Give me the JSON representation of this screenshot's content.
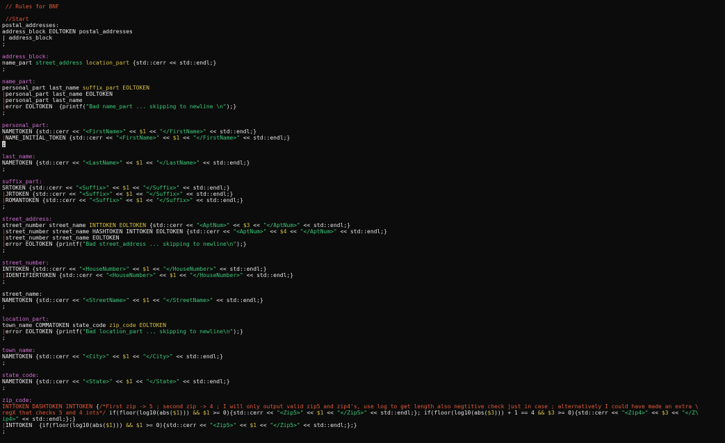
{
  "colors": {
    "background": "#0c0c0c",
    "plain": "#e6e6e6",
    "rule": "#d070d0",
    "comment": "#e05a3a",
    "string": "#3cc87a",
    "number": "#d6c040"
  },
  "lines": [
    [
      [
        "cmt",
        " // Rules for BNF"
      ]
    ],
    [],
    [
      [
        "cmt",
        " //Start"
      ]
    ],
    [
      [
        "plain",
        "postal_addresses:"
      ]
    ],
    [
      [
        "plain",
        "address_block EOLTOKEN postal_addresses"
      ]
    ],
    [
      [
        "plain",
        "| address_block"
      ]
    ],
    [
      [
        "plain",
        ";"
      ]
    ],
    [],
    [
      [
        "rule",
        "address_block:"
      ]
    ],
    [
      [
        "plain",
        "name_part "
      ],
      [
        "green",
        "street_address"
      ],
      [
        "plain",
        " "
      ],
      [
        "kw",
        "location_part"
      ],
      [
        "plain",
        " {std::cerr << std::endl;}"
      ]
    ],
    [
      [
        "plain",
        ";"
      ]
    ],
    [],
    [
      [
        "rule",
        "name_part:"
      ]
    ],
    [
      [
        "plain",
        "personal_part last_name "
      ],
      [
        "kw",
        "suffix_part"
      ],
      [
        "plain",
        " "
      ],
      [
        "kw",
        "EOLTOKEN"
      ]
    ],
    [
      [
        "pipe",
        "|"
      ],
      [
        "plain",
        "personal_part last_name EOLTOKEN"
      ]
    ],
    [
      [
        "pipe",
        "|"
      ],
      [
        "plain",
        "personal_part last_name"
      ]
    ],
    [
      [
        "pipe",
        "|"
      ],
      [
        "plain",
        "error EOLTOKEN  {printf("
      ],
      [
        "str",
        "\"Bad name_part ... skipping to newline \\n\""
      ],
      [
        "plain",
        ");}"
      ]
    ],
    [
      [
        "plain",
        ";"
      ]
    ],
    [],
    [
      [
        "rule",
        "personal_part:"
      ]
    ],
    [
      [
        "plain",
        "NAMETOKEN {std::cerr << "
      ],
      [
        "str",
        "\"<FirstName>\""
      ],
      [
        "plain",
        " << "
      ],
      [
        "var",
        "$1"
      ],
      [
        "plain",
        " << "
      ],
      [
        "str",
        "\"</FirstName>\""
      ],
      [
        "plain",
        " << std::endl;}"
      ]
    ],
    [
      [
        "pipe",
        "|"
      ],
      [
        "plain",
        "NAME_INITIAL_TOKEN {std::cerr << "
      ],
      [
        "str",
        "\"<FirstName>\""
      ],
      [
        "plain",
        " << "
      ],
      [
        "var",
        "$1"
      ],
      [
        "plain",
        " << "
      ],
      [
        "str",
        "\"</FirstName>\""
      ],
      [
        "plain",
        " << std::endl;}"
      ]
    ],
    [
      [
        "cursor",
        ";"
      ]
    ],
    [],
    [
      [
        "rule",
        "last_name:"
      ]
    ],
    [
      [
        "plain",
        "NAMETOKEN {std::cerr << "
      ],
      [
        "str",
        "\"<LastName>\""
      ],
      [
        "plain",
        " << "
      ],
      [
        "var",
        "$1"
      ],
      [
        "plain",
        " << "
      ],
      [
        "str",
        "\"</LastName>\""
      ],
      [
        "plain",
        " << std::endl;}"
      ]
    ],
    [
      [
        "plain",
        ";"
      ]
    ],
    [],
    [
      [
        "rule",
        "suffix_part:"
      ]
    ],
    [
      [
        "plain",
        "SRTOKEN {std::cerr << "
      ],
      [
        "str",
        "\"<Suffix>\""
      ],
      [
        "plain",
        " << "
      ],
      [
        "var",
        "$1"
      ],
      [
        "plain",
        " << "
      ],
      [
        "str",
        "\"</Suffix>\""
      ],
      [
        "plain",
        " << std::endl;}"
      ]
    ],
    [
      [
        "pipe",
        "|"
      ],
      [
        "plain",
        "JRTOKEN {std::cerr << "
      ],
      [
        "str",
        "\"<Suffix>\""
      ],
      [
        "plain",
        " << "
      ],
      [
        "var",
        "$1"
      ],
      [
        "plain",
        " << "
      ],
      [
        "str",
        "\"</Suffix>\""
      ],
      [
        "plain",
        " << std::endl;}"
      ]
    ],
    [
      [
        "pipe",
        "|"
      ],
      [
        "plain",
        "ROMANTOKEN {std::cerr << "
      ],
      [
        "str",
        "\"<Suffix>\""
      ],
      [
        "plain",
        " << "
      ],
      [
        "var",
        "$1"
      ],
      [
        "plain",
        " << "
      ],
      [
        "str",
        "\"</Suffix>\""
      ],
      [
        "plain",
        " << std::endl;}"
      ]
    ],
    [
      [
        "plain",
        ";"
      ]
    ],
    [],
    [
      [
        "rule",
        "street_address:"
      ]
    ],
    [
      [
        "plain",
        "street_number street_name "
      ],
      [
        "kw",
        "INTTOKEN"
      ],
      [
        "plain",
        " "
      ],
      [
        "kw",
        "EOLTOKEN"
      ],
      [
        "plain",
        " {std::cerr << "
      ],
      [
        "str",
        "\"<AptNum>\""
      ],
      [
        "plain",
        " << "
      ],
      [
        "var",
        "$3"
      ],
      [
        "plain",
        " << "
      ],
      [
        "str",
        "\"</AptNum>\""
      ],
      [
        "plain",
        " << std::endl;}"
      ]
    ],
    [
      [
        "pipe",
        "|"
      ],
      [
        "plain",
        "street_number street_name HASHTOKEN INTTOKEN EOLTOKEN {std::cerr << "
      ],
      [
        "str",
        "\"<AptNum>\""
      ],
      [
        "plain",
        " << "
      ],
      [
        "var",
        "$4"
      ],
      [
        "plain",
        " << "
      ],
      [
        "str",
        "\"</AptNum>\""
      ],
      [
        "plain",
        " << std::endl;}"
      ]
    ],
    [
      [
        "pipe",
        "|"
      ],
      [
        "plain",
        "street_number street_name EOLTOKEN"
      ]
    ],
    [
      [
        "pipe",
        "|"
      ],
      [
        "plain",
        "error EOLTOKEN {printf("
      ],
      [
        "str",
        "\"Bad street_address ... skipping to newline\\n\""
      ],
      [
        "plain",
        ");}"
      ]
    ],
    [
      [
        "plain",
        ";"
      ]
    ],
    [],
    [
      [
        "rule",
        "street_number:"
      ]
    ],
    [
      [
        "plain",
        "INTTOKEN {std::cerr << "
      ],
      [
        "str",
        "\"<HouseNumber>\""
      ],
      [
        "plain",
        " << "
      ],
      [
        "var",
        "$1"
      ],
      [
        "plain",
        " << "
      ],
      [
        "str",
        "\"</HouseNumber>\""
      ],
      [
        "plain",
        " << std::endl;}"
      ]
    ],
    [
      [
        "pipe",
        "|"
      ],
      [
        "plain",
        "IDENTIFIERTOKEN {std::cerr << "
      ],
      [
        "str",
        "\"<HouseNumber>\""
      ],
      [
        "plain",
        " << "
      ],
      [
        "var",
        "$1"
      ],
      [
        "plain",
        " << "
      ],
      [
        "str",
        "\"</HouseNumber>\""
      ],
      [
        "plain",
        " << std::endl;}"
      ]
    ],
    [
      [
        "plain",
        ";"
      ]
    ],
    [],
    [
      [
        "plain",
        "street_name:"
      ]
    ],
    [
      [
        "plain",
        "NAMETOKEN {std::cerr << "
      ],
      [
        "str",
        "\"<StreetName>\""
      ],
      [
        "plain",
        " << "
      ],
      [
        "var",
        "$1"
      ],
      [
        "plain",
        " << "
      ],
      [
        "str",
        "\"</StreetName>\""
      ],
      [
        "plain",
        " << std::endl;}"
      ]
    ],
    [
      [
        "plain",
        ";"
      ]
    ],
    [],
    [
      [
        "rule",
        "location_part:"
      ]
    ],
    [
      [
        "plain",
        "town_name COMMATOKEN state_code "
      ],
      [
        "kw",
        "zip_code"
      ],
      [
        "plain",
        " "
      ],
      [
        "kw",
        "EOLTOKEN"
      ]
    ],
    [
      [
        "pipe",
        "|"
      ],
      [
        "plain",
        "error EOLTOKEN {printf("
      ],
      [
        "str",
        "\"Bad location_part ... skipping to newline\\n\""
      ],
      [
        "plain",
        ");}"
      ]
    ],
    [
      [
        "plain",
        ";"
      ]
    ],
    [],
    [
      [
        "rule",
        "town_name:"
      ]
    ],
    [
      [
        "plain",
        "NAMETOKEN {std::cerr << "
      ],
      [
        "str",
        "\"<City>\""
      ],
      [
        "plain",
        " << "
      ],
      [
        "var",
        "$1"
      ],
      [
        "plain",
        " << "
      ],
      [
        "str",
        "\"</City>\""
      ],
      [
        "plain",
        " << std::endl;}"
      ]
    ],
    [
      [
        "plain",
        ";"
      ]
    ],
    [],
    [
      [
        "rule",
        "state_code:"
      ]
    ],
    [
      [
        "plain",
        "NAMETOKEN {std::cerr << "
      ],
      [
        "str",
        "\"<State>\""
      ],
      [
        "plain",
        " << "
      ],
      [
        "var",
        "$1"
      ],
      [
        "plain",
        " << "
      ],
      [
        "str",
        "\"</State>\""
      ],
      [
        "plain",
        " << std::endl;}"
      ]
    ],
    [
      [
        "plain",
        ";"
      ]
    ],
    [],
    [
      [
        "rule",
        "zip_code:"
      ]
    ],
    [
      [
        "red",
        "INTTOKEN DASHTOKEN INTTOKEN"
      ],
      [
        "plain",
        " {"
      ],
      [
        "cmt",
        "/*First zip -> 5 ; second zip -> 4 ; I will only output valid zip5 and zip4's, use log to get length also negtitive check just in case ; alternatively I could have made an extra \\"
      ]
    ],
    [
      [
        "cmt",
        "regX that checks 5 and 4 ints*/"
      ],
      [
        "plain",
        " if(floor(log10(abs("
      ],
      [
        "var",
        "$1"
      ],
      [
        "plain",
        "))) "
      ],
      [
        "kw",
        "&&"
      ],
      [
        "plain",
        " "
      ],
      [
        "var",
        "$1"
      ],
      [
        "plain",
        " >= 0){std::cerr << "
      ],
      [
        "str",
        "\"<Zip5>\""
      ],
      [
        "plain",
        " << "
      ],
      [
        "var",
        "$1"
      ],
      [
        "plain",
        " << "
      ],
      [
        "str",
        "\"</Zip5>\""
      ],
      [
        "plain",
        " << std::endl;}; if(floor(log10(abs("
      ],
      [
        "var",
        "$3"
      ],
      [
        "plain",
        "))) + 1 == 4 "
      ],
      [
        "kw",
        "&&"
      ],
      [
        "plain",
        " "
      ],
      [
        "var",
        "$3"
      ],
      [
        "plain",
        " >= 0){std::cerr << "
      ],
      [
        "str",
        "\"<Zip4>\""
      ],
      [
        "plain",
        " << "
      ],
      [
        "var",
        "$3"
      ],
      [
        "plain",
        " << "
      ],
      [
        "str",
        "\"</Z\\"
      ]
    ],
    [
      [
        "str",
        "ip4>\""
      ],
      [
        "plain",
        " << std::endl;};}"
      ]
    ],
    [
      [
        "pipe",
        "|"
      ],
      [
        "plain",
        "INTTOKEN  {if(floor(log10(abs("
      ],
      [
        "var",
        "$1"
      ],
      [
        "plain",
        "))) "
      ],
      [
        "kw",
        "&&"
      ],
      [
        "plain",
        " "
      ],
      [
        "var",
        "$1"
      ],
      [
        "plain",
        " >= 0){std::cerr << "
      ],
      [
        "str",
        "\"<Zip5>\""
      ],
      [
        "plain",
        " << "
      ],
      [
        "var",
        "$1"
      ],
      [
        "plain",
        " << "
      ],
      [
        "str",
        "\"</Zip5>\""
      ],
      [
        "plain",
        " << std::endl;};}"
      ]
    ],
    [
      [
        "plain",
        ";"
      ]
    ]
  ]
}
